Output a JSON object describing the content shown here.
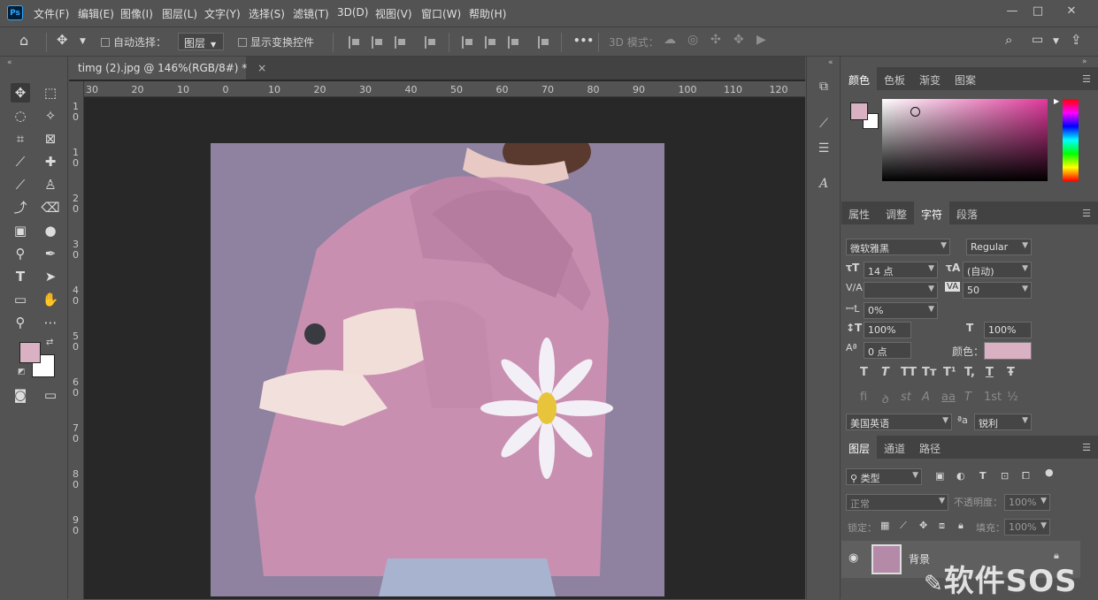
{
  "menu": {
    "items": [
      "文件(F)",
      "编辑(E)",
      "图像(I)",
      "图层(L)",
      "文字(Y)",
      "选择(S)",
      "滤镜(T)",
      "3D(D)",
      "视图(V)",
      "窗口(W)",
      "帮助(H)"
    ],
    "ps_badge": "Ps"
  },
  "options": {
    "auto_select_label": "自动选择：",
    "auto_select_value": "图层",
    "show_transform_label": "显示变换控件",
    "more_label": "•••",
    "mode_3d_label": "3D 模式："
  },
  "document": {
    "tab_title": "timg (2).jpg @ 146%(RGB/8#) *",
    "close_glyph": "×",
    "hruler_labels": [
      "30",
      "20",
      "10",
      "0",
      "10",
      "20",
      "30",
      "40",
      "50",
      "60",
      "70",
      "80",
      "90",
      "100",
      "110",
      "120"
    ],
    "vruler_labels": [
      "1",
      "0",
      "1",
      "0",
      "2",
      "0",
      "3",
      "0",
      "4",
      "0",
      "5",
      "0",
      "6",
      "0",
      "7",
      "0",
      "8",
      "0",
      "9",
      "0"
    ]
  },
  "color_panel": {
    "tabs": [
      "颜色",
      "色板",
      "渐变",
      "图案"
    ],
    "active_tab": "颜色",
    "foreground": "#d9b1c2",
    "background": "#ffffff",
    "hue_color": "#e03a9c"
  },
  "character_panel": {
    "tabs": [
      "属性",
      "调整",
      "字符",
      "段落"
    ],
    "active_tab": "字符",
    "font_family": "微软雅黑",
    "font_style": "Regular",
    "size_value": "14 点",
    "leading_value": "(自动)",
    "tracking_value": "50",
    "scale_percent": "0%",
    "vscale_value": "100%",
    "hscale_value": "100%",
    "baseline_value": "0 点",
    "color_label": "颜色：",
    "text_color": "#d9b1c2",
    "language": "美国英语",
    "aa_label": "ªa",
    "antialias": "锐利",
    "style_glyphs": [
      "T",
      "T",
      "TT",
      "Tт",
      "T¹",
      "T,",
      "T",
      "Ŧ"
    ],
    "opentype_glyphs": [
      "fi",
      "ꝺ",
      "st",
      "A",
      "aa",
      "T",
      "1st",
      "½"
    ]
  },
  "layers_panel": {
    "tabs": [
      "图层",
      "通道",
      "路径"
    ],
    "active_tab": "图层",
    "filter_kind": "类型",
    "blend_mode": "正常",
    "opacity_label": "不透明度：",
    "opacity_value": "100%",
    "lock_label": "锁定：",
    "fill_label": "填充：",
    "fill_value": "100%",
    "layer_name": "背景"
  },
  "watermark": {
    "text": "软件SOS"
  }
}
